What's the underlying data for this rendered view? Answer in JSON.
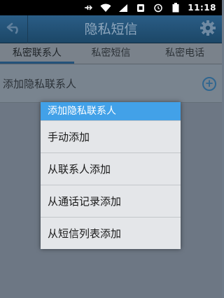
{
  "status_bar": {
    "time": "11:18",
    "icons": [
      "usb-icon",
      "wifi-icon",
      "signal-icon",
      "sim-icon",
      "alarm-icon",
      "battery-icon"
    ]
  },
  "header": {
    "title": "隐私短信",
    "back_icon": "back-arrow-icon",
    "settings_icon": "gear-icon"
  },
  "tabs": [
    {
      "label": "私密联系人",
      "active": true
    },
    {
      "label": "私密短信",
      "active": false
    },
    {
      "label": "私密电话",
      "active": false
    }
  ],
  "content": {
    "add_row_label": "添加隐私联系人",
    "add_icon": "plus-circle-icon"
  },
  "dialog": {
    "title": "添加隐私联系人",
    "items": [
      {
        "label": "手动添加"
      },
      {
        "label": "从联系人添加"
      },
      {
        "label": "从通话记录添加"
      },
      {
        "label": "从短信列表添加"
      }
    ]
  },
  "colors": {
    "dialog_title_bg": "#42a1e8",
    "header_bg": "#1c4767",
    "overlay": "#6d7784"
  }
}
